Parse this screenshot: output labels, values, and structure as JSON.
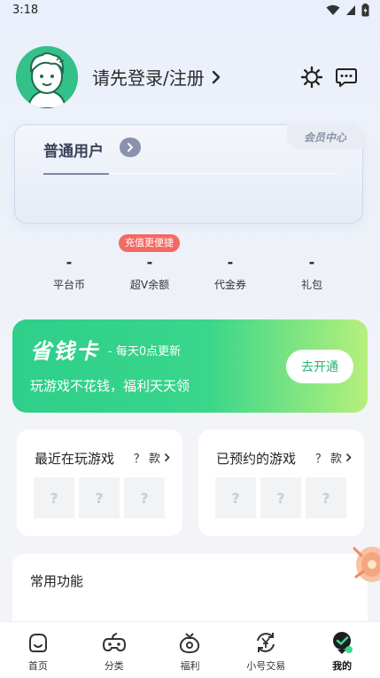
{
  "status_bar": {
    "time": "3:18"
  },
  "header": {
    "login_text": "请先登录/注册"
  },
  "member_card": {
    "level": "普通用户",
    "center_tag": "会员中心"
  },
  "stats": [
    {
      "value": "-",
      "label": "平台币"
    },
    {
      "value": "-",
      "label": "超V余额"
    },
    {
      "value": "-",
      "label": "代金券"
    },
    {
      "value": "-",
      "label": "礼包"
    }
  ],
  "stats_badge": "充值更便捷",
  "savings_card": {
    "title": "省钱卡",
    "subtitle": "- 每天0点更新",
    "description": "玩游戏不花钱，福利天天领",
    "button": "去开通"
  },
  "recent_games": {
    "title": "最近在玩游戏",
    "count": "？ 款",
    "placeholder": "?"
  },
  "reserved_games": {
    "title": "已预约的游戏",
    "count": "？ 款",
    "placeholder": "?"
  },
  "common_functions": {
    "title": "常用功能"
  },
  "bottom_nav": [
    {
      "label": "首页",
      "icon": "home-icon"
    },
    {
      "label": "分类",
      "icon": "gamepad-icon"
    },
    {
      "label": "福利",
      "icon": "gift-bag-icon"
    },
    {
      "label": "小号交易",
      "icon": "yuan-exchange-icon"
    },
    {
      "label": "我的",
      "icon": "profile-icon"
    }
  ],
  "colors": {
    "accent_green": "#2ecf8a",
    "badge_red": "#f26a62",
    "member_text": "#3a4259"
  }
}
